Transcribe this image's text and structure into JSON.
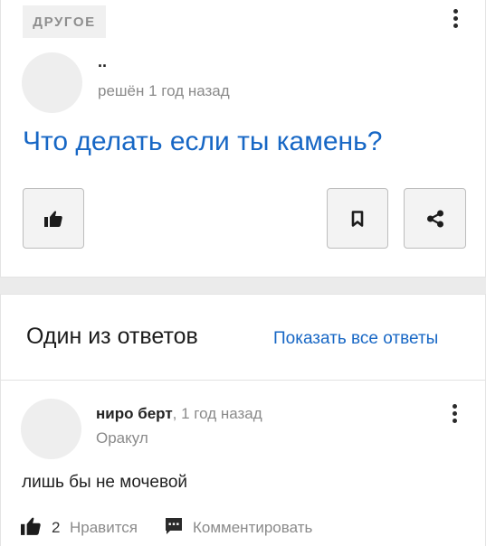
{
  "question": {
    "category_tag": "ДРУГОЕ",
    "author": "..",
    "status": "решён 1 год назад",
    "title": "Что делать если ты камень?",
    "actions": {
      "like": "thumbs-up-icon",
      "bookmark": "bookmark-icon",
      "share": "share-icon",
      "more": "more-vertical-icon"
    }
  },
  "answers_section": {
    "heading": "Один из ответов",
    "show_all_link": "Показать все ответы"
  },
  "answer": {
    "author": "ниро берт",
    "separator": ", ",
    "time": "1 год назад",
    "rank": "Оракул",
    "text": "лишь бы не мочевой",
    "likes_count": "2",
    "like_label": "Нравится",
    "comment_label": "Комментировать"
  },
  "colors": {
    "accent": "#1767c5",
    "muted_text": "#8a8a8a",
    "page_background": "#ebebeb"
  }
}
